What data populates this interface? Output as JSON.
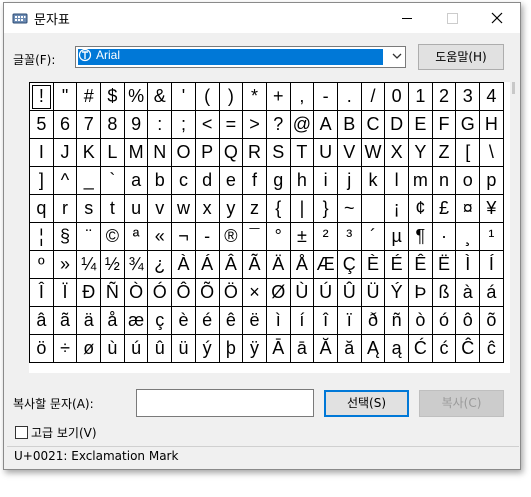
{
  "window": {
    "title": "문자표"
  },
  "font": {
    "label": "글꼴(F):",
    "selected": "Arial",
    "icon": "truetype-font-icon"
  },
  "help_button": "도움말(H)",
  "characters": [
    [
      "!",
      "\"",
      "#",
      "$",
      "%",
      "&",
      "'",
      "(",
      ")",
      "*",
      "+",
      ",",
      "-",
      ".",
      "/",
      "0",
      "1",
      "2",
      "3",
      "4"
    ],
    [
      "5",
      "6",
      "7",
      "8",
      "9",
      ":",
      ";",
      "<",
      "=",
      ">",
      "?",
      "@",
      "A",
      "B",
      "C",
      "D",
      "E",
      "F",
      "G",
      "H"
    ],
    [
      "I",
      "J",
      "K",
      "L",
      "M",
      "N",
      "O",
      "P",
      "Q",
      "R",
      "S",
      "T",
      "U",
      "V",
      "W",
      "X",
      "Y",
      "Z",
      "[",
      "\\"
    ],
    [
      "]",
      "^",
      "_",
      "`",
      "a",
      "b",
      "c",
      "d",
      "e",
      "f",
      "g",
      "h",
      "i",
      "j",
      "k",
      "l",
      "m",
      "n",
      "o",
      "p"
    ],
    [
      "q",
      "r",
      "s",
      "t",
      "u",
      "v",
      "w",
      "x",
      "y",
      "z",
      "{",
      "|",
      "}",
      "~",
      " ",
      "¡",
      "¢",
      "£",
      "¤",
      "¥"
    ],
    [
      "¦",
      "§",
      "¨",
      "©",
      "ª",
      "«",
      "¬",
      "-",
      "®",
      "¯",
      "°",
      "±",
      "²",
      "³",
      "´",
      "µ",
      "¶",
      "·",
      "¸",
      "¹"
    ],
    [
      "º",
      "»",
      "¼",
      "½",
      "¾",
      "¿",
      "À",
      "Á",
      "Â",
      "Ã",
      "Ä",
      "Å",
      "Æ",
      "Ç",
      "È",
      "É",
      "Ê",
      "Ë",
      "Ì",
      "Í"
    ],
    [
      "Î",
      "Ï",
      "Ð",
      "Ñ",
      "Ò",
      "Ó",
      "Ô",
      "Õ",
      "Ö",
      "×",
      "Ø",
      "Ù",
      "Ú",
      "Û",
      "Ü",
      "Ý",
      "Þ",
      "ß",
      "à",
      "á"
    ],
    [
      "â",
      "ã",
      "ä",
      "å",
      "æ",
      "ç",
      "è",
      "é",
      "ê",
      "ë",
      "ì",
      "í",
      "î",
      "ï",
      "ð",
      "ñ",
      "ò",
      "ó",
      "ô",
      "õ"
    ],
    [
      "ö",
      "÷",
      "ø",
      "ù",
      "ú",
      "û",
      "ü",
      "ý",
      "þ",
      "ÿ",
      "Ā",
      "ā",
      "Ă",
      "ă",
      "Ą",
      "ą",
      "Ć",
      "ć",
      "Ĉ",
      "ĉ"
    ]
  ],
  "copy": {
    "label": "복사할 문자(A):",
    "value": ""
  },
  "select_button": "선택(S)",
  "copy_button": "복사(C)",
  "advanced_view": {
    "label": "고급 보기(V)",
    "checked": false
  },
  "status": "U+0021: Exclamation Mark",
  "colors": {
    "accent": "#0078d7",
    "disabled_text": "#9a9a9a"
  }
}
